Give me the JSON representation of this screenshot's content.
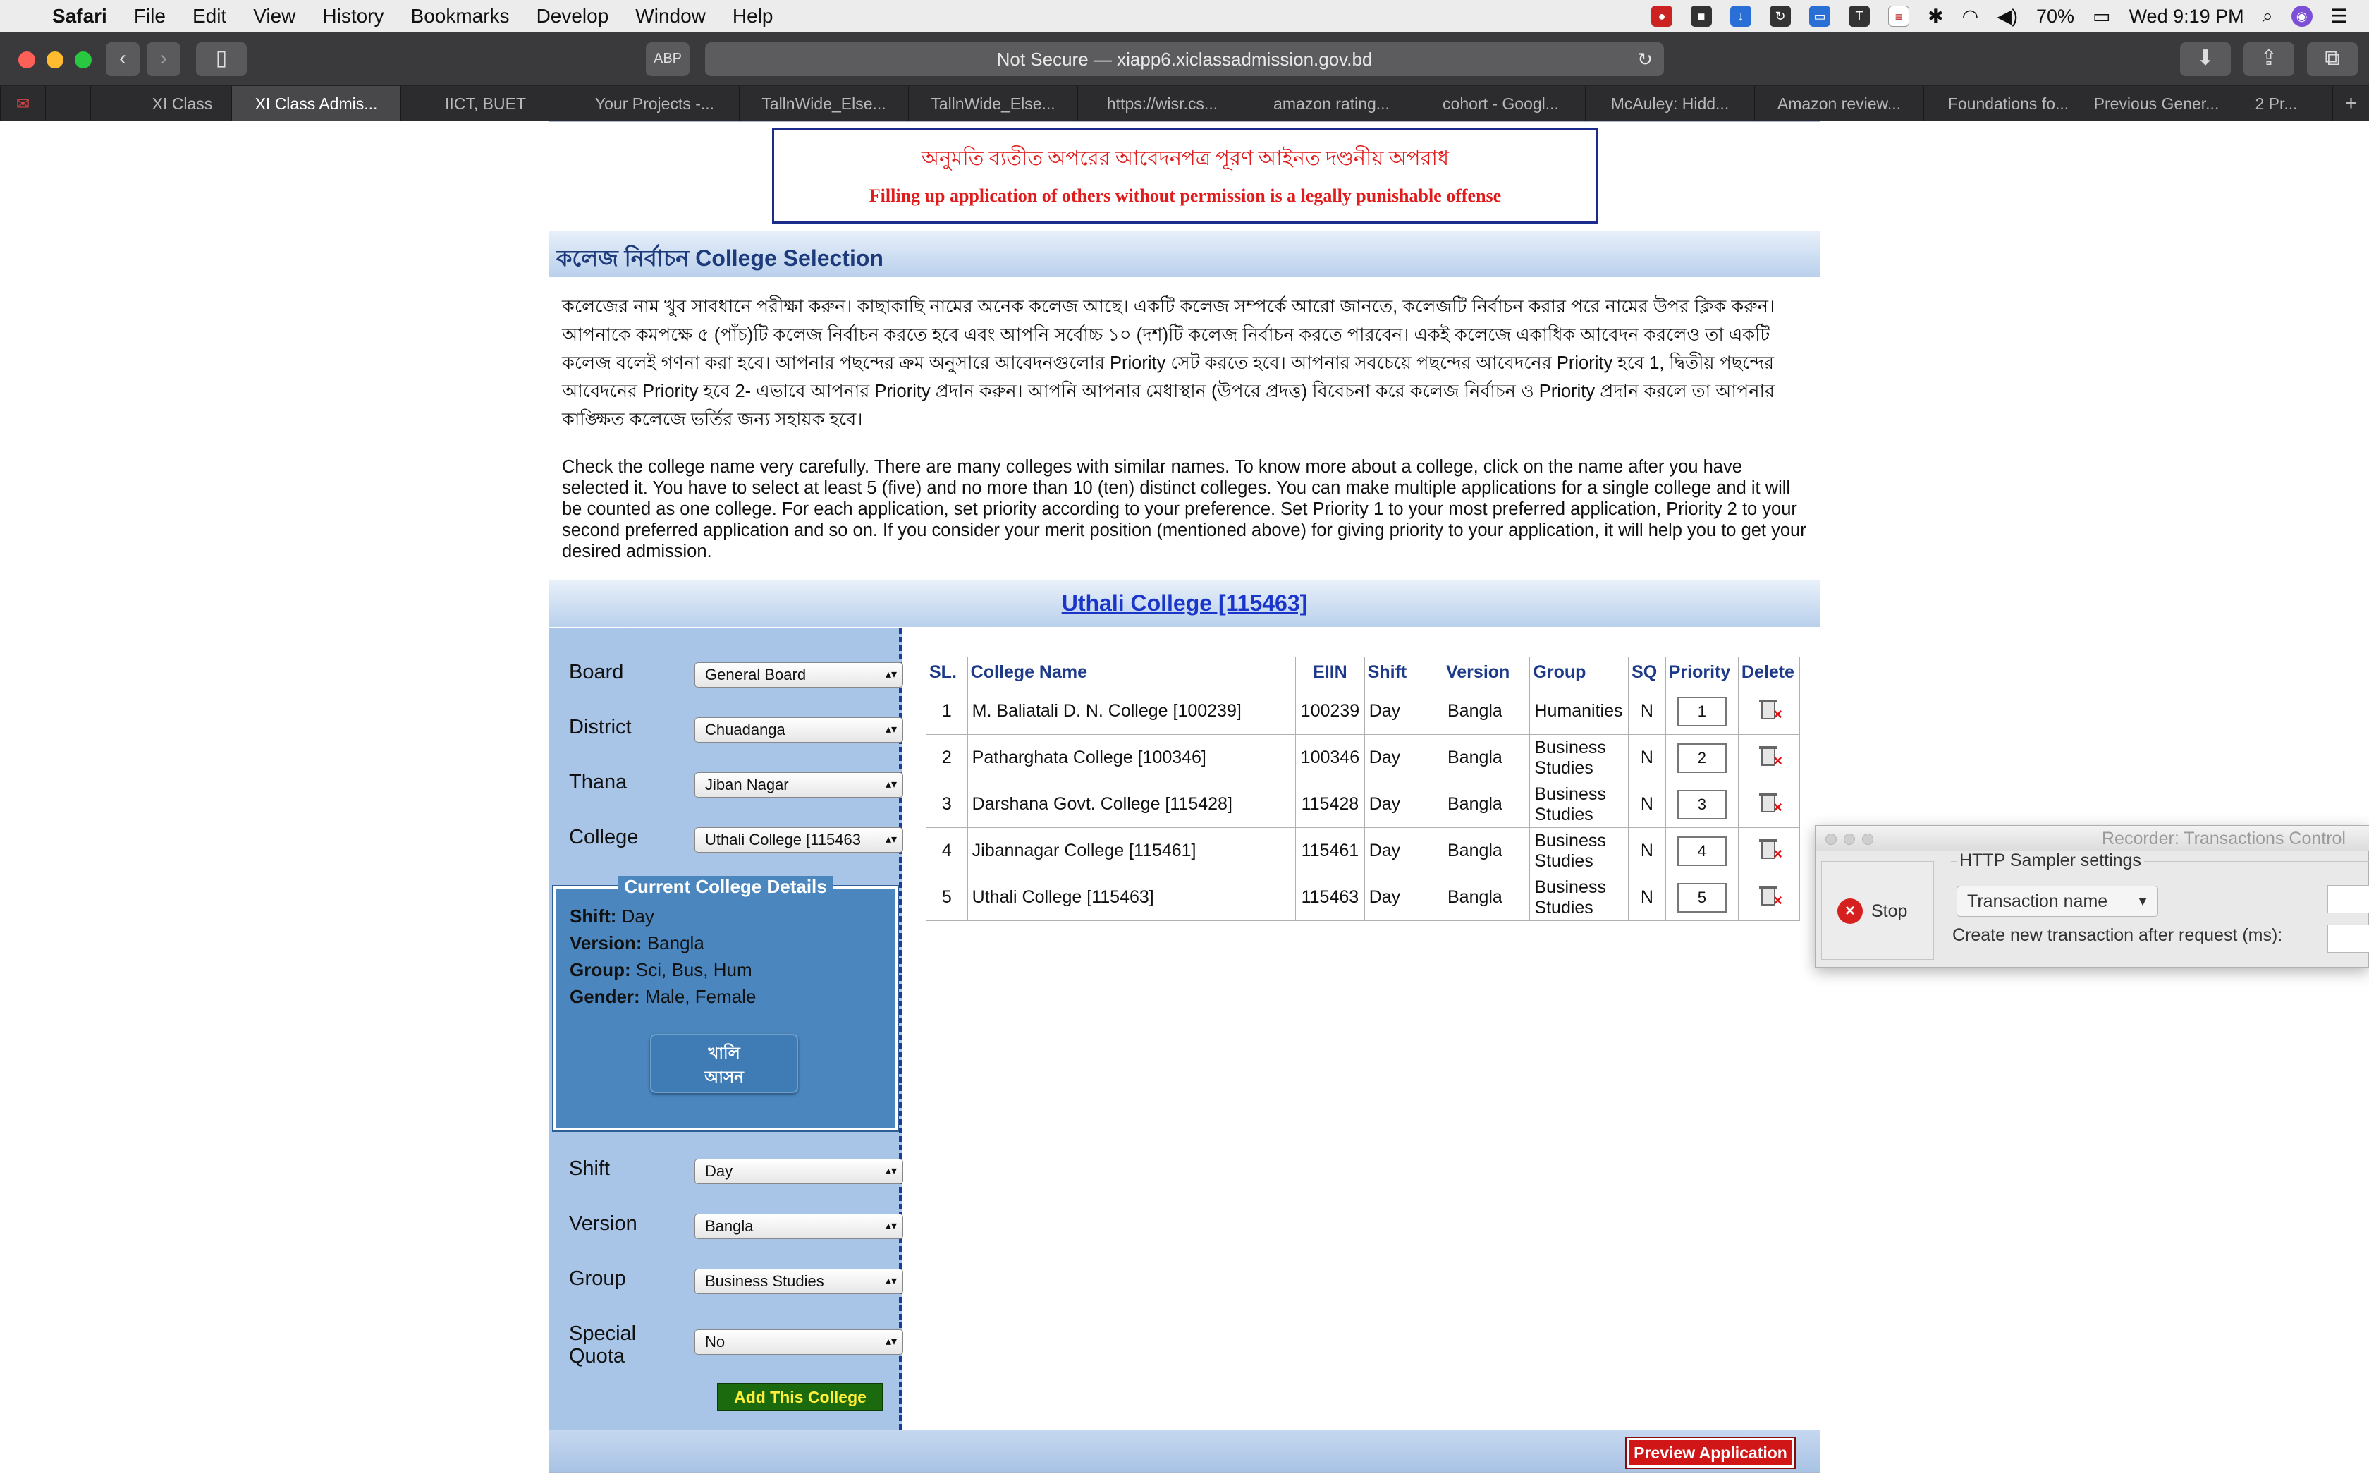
{
  "menubar": {
    "app": "Safari",
    "items": [
      "File",
      "Edit",
      "View",
      "History",
      "Bookmarks",
      "Develop",
      "Window",
      "Help"
    ],
    "battery": "70%",
    "clock": "Wed 9:19 PM"
  },
  "browser": {
    "url": "Not Secure — xiapp6.xiclassadmission.gov.bd",
    "tabs": [
      "XI Class",
      "XI Class Admis...",
      "IICT, BUET",
      "Your Projects -...",
      "TallnWide_Else...",
      "TallnWide_Else...",
      "https://wisr.cs...",
      "amazon rating...",
      "cohort - Googl...",
      "McAuley: Hidd...",
      "Amazon review...",
      "Foundations fo...",
      "Previous Gener...",
      "2 Pr..."
    ]
  },
  "banner": {
    "bangla": "অনুমতি ব্যতীত অপরের আবেদনপত্র পূরণ আইনত দণ্ডনীয় অপরাধ",
    "english": "Filling up application of others without permission is a legally punishable offense"
  },
  "section": {
    "title": "কলেজ নির্বাচন College Selection",
    "instructions_bn": "কলেজের নাম খুব সাবধানে পরীক্ষা করুন। কাছাকাছি নামের অনেক কলেজ আছে। একটি কলেজ সম্পর্কে আরো জানতে, কলেজটি নির্বাচন করার পরে নামের উপর ক্লিক করুন। আপনাকে কমপক্ষে ৫ (পাঁচ)টি কলেজ নির্বাচন করতে হবে এবং আপনি সর্বোচ্চ ১০ (দশ)টি কলেজ নির্বাচন করতে পারবেন। একই কলেজে একাধিক আবেদন করলেও তা একটি কলেজ বলেই গণনা করা হবে। আপনার পছন্দের ক্রম অনুসারে আবেদনগুলোর Priority সেট করতে হবে। আপনার সবচেয়ে পছন্দের আবেদনের Priority হবে 1, দ্বিতীয় পছন্দের আবেদনের Priority হবে 2- এভাবে আপনার Priority প্রদান করুন। আপনি আপনার মেধাস্থান (উপরে প্রদত্ত) বিবেচনা করে কলেজ নির্বাচন ও Priority প্রদান করলে তা আপনার কাঙ্ক্ষিত কলেজে ভর্তির জন্য সহায়ক হবে।",
    "instructions_en": "Check the college name very carefully. There are many colleges with similar names. To know more about a college, click on the name after you have selected it. You have to select at least 5 (five) and no more than 10 (ten) distinct colleges. You can make multiple applications for a single college and it will be counted as one college. For each application, set priority according to your preference. Set Priority 1 to your most preferred application, Priority 2 to your second preferred application and so on. If you consider your merit position (mentioned above) for giving priority to your application, it will help you to get your desired admission.",
    "selected_college_link": "Uthali College [115463]"
  },
  "form": {
    "board": {
      "label": "Board",
      "value": "General Board"
    },
    "district": {
      "label": "District",
      "value": "Chuadanga"
    },
    "thana": {
      "label": "Thana",
      "value": "Jiban Nagar"
    },
    "college": {
      "label": "College",
      "value": "Uthali College [115463"
    },
    "shift": {
      "label": "Shift",
      "value": "Day"
    },
    "version": {
      "label": "Version",
      "value": "Bangla"
    },
    "group": {
      "label": "Group",
      "value": "Business Studies"
    },
    "quota": {
      "label": "Special Quota",
      "value": "No"
    },
    "add_button": "Add This College"
  },
  "details": {
    "title": "Current College Details",
    "shift_label": "Shift:",
    "shift": "Day",
    "version_label": "Version:",
    "version": "Bangla",
    "group_label": "Group:",
    "group": "Sci, Bus, Hum",
    "gender_label": "Gender:",
    "gender": "Male, Female",
    "vacant_line1": "খালি",
    "vacant_line2": "আসন"
  },
  "table": {
    "headers": [
      "SL.",
      "College Name",
      "EIIN",
      "Shift",
      "Version",
      "Group",
      "SQ",
      "Priority",
      "Delete"
    ],
    "rows": [
      {
        "sl": "1",
        "name": "M. Baliatali D. N. College [100239]",
        "eiin": "100239",
        "shift": "Day",
        "version": "Bangla",
        "group": "Humanities",
        "sq": "N",
        "priority": "1"
      },
      {
        "sl": "2",
        "name": "Patharghata College [100346]",
        "eiin": "100346",
        "shift": "Day",
        "version": "Bangla",
        "group": "Business Studies",
        "sq": "N",
        "priority": "2"
      },
      {
        "sl": "3",
        "name": "Darshana Govt. College [115428]",
        "eiin": "115428",
        "shift": "Day",
        "version": "Bangla",
        "group": "Business Studies",
        "sq": "N",
        "priority": "3"
      },
      {
        "sl": "4",
        "name": "Jibannagar College [115461]",
        "eiin": "115461",
        "shift": "Day",
        "version": "Bangla",
        "group": "Business Studies",
        "sq": "N",
        "priority": "4"
      },
      {
        "sl": "5",
        "name": "Uthali College [115463]",
        "eiin": "115463",
        "shift": "Day",
        "version": "Bangla",
        "group": "Business Studies",
        "sq": "N",
        "priority": "5"
      }
    ]
  },
  "preview_button": "Preview Application",
  "recorder": {
    "title": "Recorder: Transactions Control",
    "stop": "Stop",
    "settings_legend": "HTTP Sampler settings",
    "transaction_select": "Transaction name",
    "create_new_label": "Create new transaction after request (ms):"
  }
}
